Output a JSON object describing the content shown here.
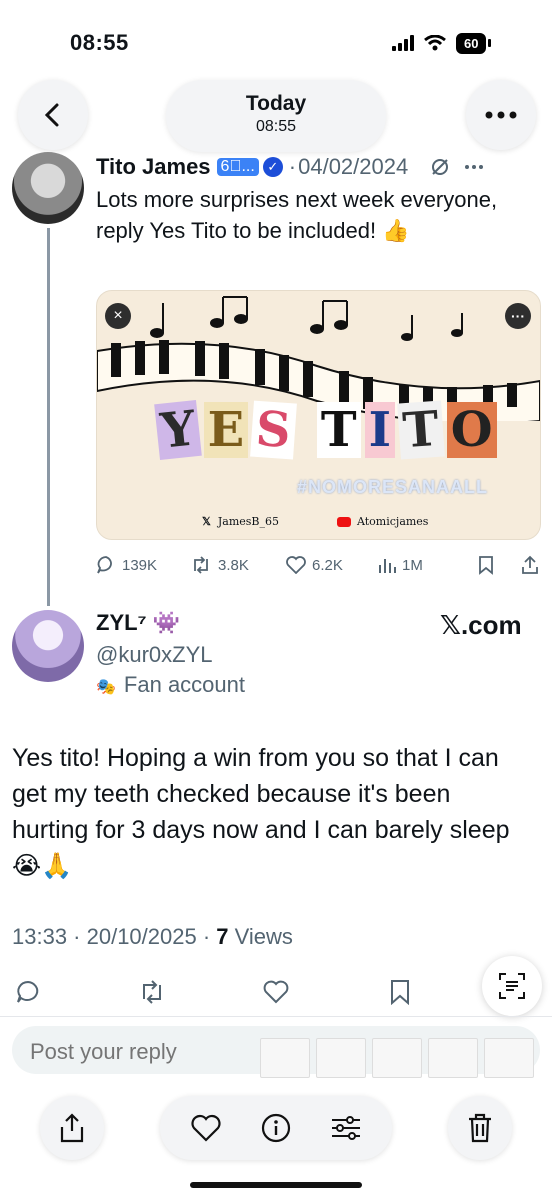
{
  "status_bar": {
    "time": "08:55",
    "battery": "60"
  },
  "top_bar": {
    "date_title": "Today",
    "date_time": "08:55"
  },
  "quoted_tweet": {
    "author_name": "Tito James",
    "badge": "6⃣...",
    "dot": "·",
    "date": "04/02/2024",
    "text": "Lots more surprises next week everyone, reply Yes Tito to be included! 👍",
    "media": {
      "title_letters": [
        "Y",
        "E",
        "S",
        "T",
        "I",
        "T",
        "O"
      ],
      "hashtag": "#NOMORESANAALL",
      "credit_x": "JamesB_65",
      "credit_youtube": "Atomicjames"
    },
    "actions": {
      "replies": "139K",
      "reposts": "3.8K",
      "likes": "6.2K",
      "views": "1M"
    }
  },
  "reply": {
    "author_name": "ZYL⁷ 👾",
    "handle": "@kur0xZYL",
    "fan_label": "Fan account",
    "site": "𝕏.com",
    "text": "Yes tito! Hoping a win from you so that I can get my teeth checked because it's been hurting for 3 days now and I can barely sleep 😭🙏",
    "time_date": "13:33 · 20/10/2025 · ",
    "views_count": "7",
    "views_label": " Views"
  },
  "reply_box": {
    "placeholder": "Post your reply"
  },
  "icons": [
    "back-icon",
    "more-icon",
    "mute-icon",
    "kebab-icon",
    "reply-icon",
    "repost-icon",
    "like-icon",
    "views-icon",
    "bookmark-icon",
    "share-icon",
    "scan-text-icon",
    "share-sheet-icon",
    "heart-icon",
    "info-icon",
    "adjust-icon",
    "trash-icon"
  ],
  "colors": {
    "muted_text": "#536471",
    "verified_blue": "#1d4ed8",
    "brand_black": "#0f1419"
  }
}
